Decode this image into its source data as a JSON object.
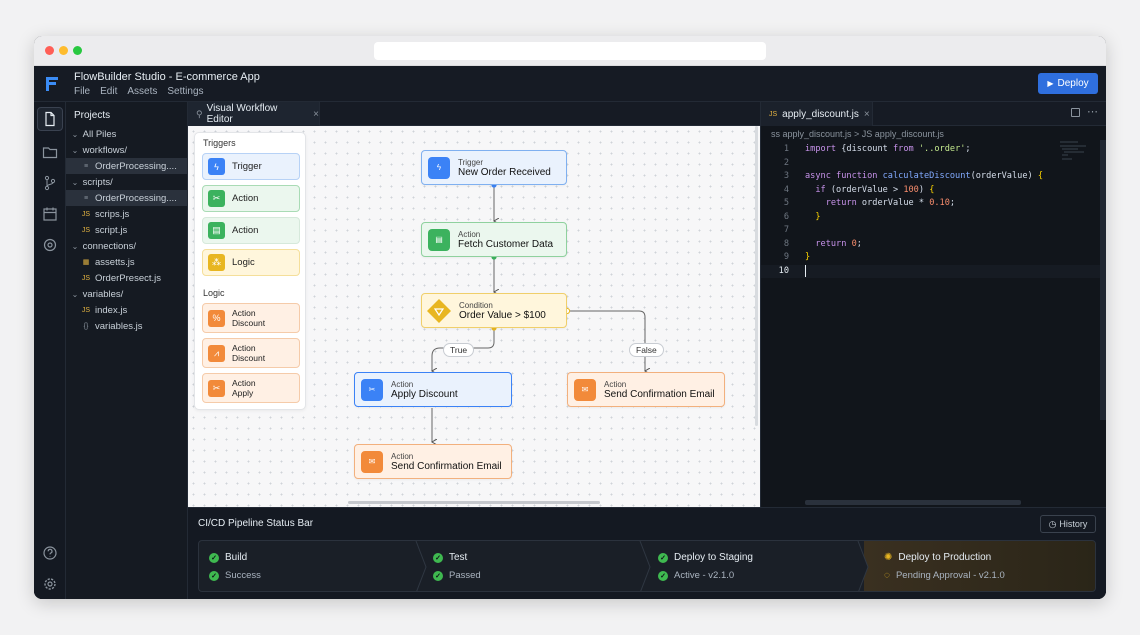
{
  "app": {
    "title": "FlowBuilder Studio - E-commerce App",
    "menu": [
      "File",
      "Edit",
      "Assets",
      "Settings"
    ],
    "deploy_label": "Deploy"
  },
  "explorer": {
    "header": "Projects",
    "items": [
      {
        "label": "All Piles",
        "indent": 0,
        "chev": "⌄",
        "icon": ""
      },
      {
        "label": "workflows/",
        "indent": 0,
        "chev": "⌄",
        "icon": ""
      },
      {
        "label": "OrderProcessing....",
        "indent": 1,
        "chev": "",
        "icon": "≡",
        "selected": true
      },
      {
        "label": "scripts/",
        "indent": 0,
        "chev": "⌄",
        "icon": ""
      },
      {
        "label": "OrderProcessing....",
        "indent": 1,
        "chev": "",
        "icon": "≡",
        "selected": true
      },
      {
        "label": "scrips.js",
        "indent": 1,
        "chev": "",
        "icon": "JS"
      },
      {
        "label": "script.js",
        "indent": 1,
        "chev": "",
        "icon": "JS"
      },
      {
        "label": "connections/",
        "indent": 0,
        "chev": "⌄",
        "icon": ""
      },
      {
        "label": "assetts.js",
        "indent": 1,
        "chev": "",
        "icon": "▦"
      },
      {
        "label": "OrderPresect.js",
        "indent": 1,
        "chev": "",
        "icon": "JS"
      },
      {
        "label": "variables/",
        "indent": 0,
        "chev": "⌄",
        "icon": ""
      },
      {
        "label": "index.js",
        "indent": 1,
        "chev": "",
        "icon": "JS"
      },
      {
        "label": "variables.js",
        "indent": 1,
        "chev": "",
        "icon": "{}"
      }
    ]
  },
  "workflow_tab": {
    "label": "Visual Workflow Editor",
    "close": "×"
  },
  "palette": {
    "triggers_header": "Triggers",
    "logic_header": "Logic",
    "triggers": [
      "Trigger",
      "Action",
      "Action",
      "Logic"
    ],
    "logic": [
      {
        "l1": "Action",
        "l2": "Discount"
      },
      {
        "l1": "Action",
        "l2": "Discount"
      },
      {
        "l1": "Action",
        "l2": "Apply"
      }
    ]
  },
  "nodes": {
    "trigger": {
      "kind": "Trigger",
      "name": "New Order Received"
    },
    "fetch": {
      "kind": "Action",
      "name": "Fetch Customer Data"
    },
    "condition": {
      "kind": "Condition",
      "name": "Order Value > $100"
    },
    "apply": {
      "kind": "Action",
      "name": "Apply Discount"
    },
    "email_right": {
      "kind": "Action",
      "name": "Send Confirmation Email"
    },
    "email_bottom": {
      "kind": "Action",
      "name": "Send Confirmation Email"
    }
  },
  "edge_labels": {
    "true": "True",
    "false": "False"
  },
  "editor": {
    "tab_label": "apply_discount.js",
    "tab_prefix": "JS",
    "breadcrumb": "ss apply_discount.js  >  JS apply_discount.js",
    "lines": [
      "1",
      "2",
      "3",
      "4",
      "5",
      "6",
      "7",
      "8",
      "9",
      "10"
    ]
  },
  "pipeline": {
    "title": "CI/CD Pipeline Status Bar",
    "history_label": "History",
    "stages": [
      {
        "name": "Build",
        "status": "Success"
      },
      {
        "name": "Test",
        "status": "Passed"
      },
      {
        "name": "Deploy to Staging",
        "status": "Active - v2.1.0"
      },
      {
        "name": "Deploy to Production",
        "status": "Pending Approval - v2.1.0"
      }
    ]
  },
  "colors": {
    "accent": "#2f6fde",
    "success": "#3fb950",
    "pending": "#e8b621",
    "production_stage_bg": "#3a3020"
  }
}
